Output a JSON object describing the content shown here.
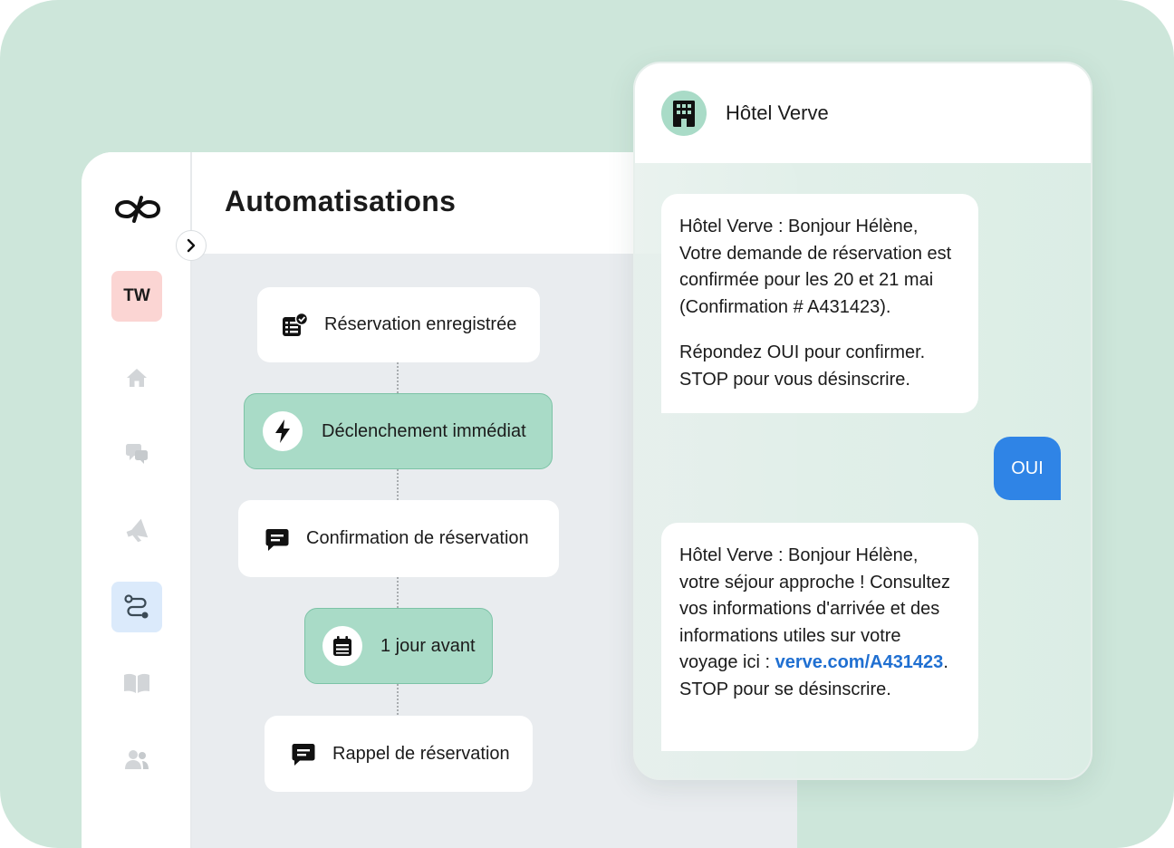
{
  "app": {
    "title": "Automatisations",
    "workspace_badge": "TW",
    "nav": [
      {
        "name": "home-icon"
      },
      {
        "name": "conversations-icon"
      },
      {
        "name": "megaphone-icon"
      },
      {
        "name": "automation-icon",
        "active": true
      },
      {
        "name": "book-icon"
      },
      {
        "name": "contacts-icon"
      }
    ]
  },
  "workflow": {
    "steps": [
      {
        "label": "Réservation enregistrée",
        "icon": "list-check-icon",
        "style": "white"
      },
      {
        "label": "Déclenchement immédiat",
        "icon": "lightning-icon",
        "style": "green"
      },
      {
        "label": "Confirmation de réservation",
        "icon": "message-icon",
        "style": "white"
      },
      {
        "label": "1 jour avant",
        "icon": "calendar-icon",
        "style": "green"
      },
      {
        "label": "Rappel de réservation",
        "icon": "message-icon",
        "style": "white"
      }
    ]
  },
  "chat": {
    "contact_name": "Hôtel Verve",
    "contact_icon": "building-icon",
    "messages": [
      {
        "direction": "in",
        "paragraphs": [
          "Hôtel Verve : Bonjour Hélène, Votre demande de réservation est confirmée pour les 20 et 21 mai (Confirmation # A431423).",
          "Répondez OUI pour confirmer. STOP pour vous désinscrire."
        ]
      },
      {
        "direction": "out",
        "text": "OUI"
      },
      {
        "direction": "in",
        "text_before": "Hôtel Verve : Bonjour Hélène, votre séjour approche ! Consultez vos informations d'arrivée et des informations utiles sur votre voyage ici : ",
        "link": "verve.com/A431423",
        "text_after": ". STOP pour se désinscrire."
      }
    ]
  },
  "colors": {
    "background": "#cde6da",
    "accent_green": "#a9dbc7",
    "outgoing_bubble": "#2f84e6",
    "link": "#1f6fd1",
    "badge": "#fbd5d3"
  }
}
